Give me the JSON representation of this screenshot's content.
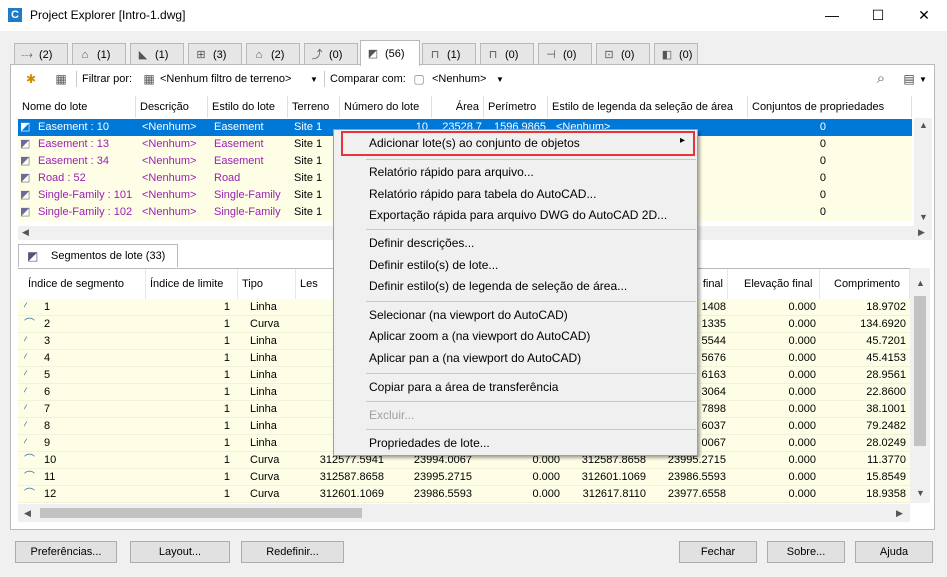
{
  "window": {
    "title": "Project Explorer [Intro-1.dwg]",
    "app_icon_letter": "C",
    "minimize": "—",
    "maximize": "☐",
    "close": "✕"
  },
  "tabs": [
    {
      "icon": "alignment-icon",
      "count": "(2)"
    },
    {
      "icon": "corridor-icon",
      "count": "(1)"
    },
    {
      "icon": "profile-icon",
      "count": "(1)"
    },
    {
      "icon": "section-icon",
      "count": "(3)"
    },
    {
      "icon": "surface-icon",
      "count": "(2)"
    },
    {
      "icon": "feature-line-icon",
      "count": "(0)"
    },
    {
      "icon": "parcel-icon",
      "count": "(56)"
    },
    {
      "icon": "structure-icon",
      "count": "(1)"
    },
    {
      "icon": "pipe-icon",
      "count": "(0)"
    },
    {
      "icon": "point-group-icon",
      "count": "(0)"
    },
    {
      "icon": "assembly-icon",
      "count": "(0)"
    },
    {
      "icon": "label-icon",
      "count": "(0)"
    }
  ],
  "toolbar": {
    "filter_label": "Filtrar por:",
    "filter_value": "<Nenhum filtro de terreno>",
    "compare_label": "Comparar com:",
    "compare_value": "<Nenhum>"
  },
  "parcels": {
    "columns": [
      "Nome do lote",
      "Descrição",
      "Estilo do lote",
      "Terreno",
      "Número do lote",
      "Área",
      "Perímetro",
      "Estilo de legenda da seleção de área",
      "Conjuntos de propriedades"
    ],
    "rows": [
      {
        "name": "Easement : 10",
        "desc": "<Nenhum>",
        "style": "Easement",
        "site": "Site 1",
        "num": "10",
        "area": "23528.7",
        "perim": "1596.9865",
        "label_style": "<Nenhum>",
        "sets": "0"
      },
      {
        "name": "Easement : 13",
        "desc": "<Nenhum>",
        "style": "Easement",
        "site": "Site 1",
        "num": "",
        "area": "",
        "perim": "",
        "label_style": "",
        "sets": "0"
      },
      {
        "name": "Easement : 34",
        "desc": "<Nenhum>",
        "style": "Easement",
        "site": "Site 1",
        "num": "",
        "area": "",
        "perim": "",
        "label_style": "",
        "sets": "0"
      },
      {
        "name": "Road : 52",
        "desc": "<Nenhum>",
        "style": "Road",
        "site": "Site 1",
        "num": "",
        "area": "",
        "perim": "",
        "label_style": "",
        "sets": "0"
      },
      {
        "name": "Single-Family : 101",
        "desc": "<Nenhum>",
        "style": "Single-Family",
        "site": "Site 1",
        "num": "",
        "area": "",
        "perim": "",
        "label_style": "",
        "sets": "0"
      },
      {
        "name": "Single-Family : 102",
        "desc": "<Nenhum>",
        "style": "Single-Family",
        "site": "Site 1",
        "num": "",
        "area": "",
        "perim": "",
        "label_style": "",
        "sets": "0"
      }
    ]
  },
  "segments_tab": "Segmentos de lote (33)",
  "segments": {
    "columns": [
      "Índice de segmento",
      "Índice de limite",
      "Tipo",
      "Les",
      "",
      "",
      "final",
      "Elevação final",
      "Comprimento"
    ],
    "rows": [
      {
        "idx": "1",
        "lim": "1",
        "type": "Linha",
        "a": "3124",
        "b": "",
        "c": "",
        "d": "",
        "e": "1408",
        "elev": "0.000",
        "len": "18.9702"
      },
      {
        "idx": "2",
        "lim": "1",
        "type": "Curva",
        "a": "3124",
        "b": "",
        "c": "",
        "d": "",
        "e": "1335",
        "elev": "0.000",
        "len": "134.6920"
      },
      {
        "idx": "3",
        "lim": "1",
        "type": "Linha",
        "a": "3125",
        "b": "",
        "c": "",
        "d": "",
        "e": "5544",
        "elev": "0.000",
        "len": "45.7201"
      },
      {
        "idx": "4",
        "lim": "1",
        "type": "Linha",
        "a": "3125",
        "b": "",
        "c": "",
        "d": "",
        "e": "5676",
        "elev": "0.000",
        "len": "45.4153"
      },
      {
        "idx": "5",
        "lim": "1",
        "type": "Linha",
        "a": "3125",
        "b": "",
        "c": "",
        "d": "",
        "e": "6163",
        "elev": "0.000",
        "len": "28.9561"
      },
      {
        "idx": "6",
        "lim": "1",
        "type": "Linha",
        "a": "3126",
        "b": "",
        "c": "",
        "d": "",
        "e": "3064",
        "elev": "0.000",
        "len": "22.8600"
      },
      {
        "idx": "7",
        "lim": "1",
        "type": "Linha",
        "a": "3126",
        "b": "",
        "c": "",
        "d": "",
        "e": "7898",
        "elev": "0.000",
        "len": "38.1001"
      },
      {
        "idx": "8",
        "lim": "1",
        "type": "Linha",
        "a": "3126",
        "b": "",
        "c": "",
        "d": "",
        "e": "6037",
        "elev": "0.000",
        "len": "79.2482"
      },
      {
        "idx": "9",
        "lim": "1",
        "type": "Linha",
        "a": "3125",
        "b": "",
        "c": "",
        "d": "",
        "e": "0067",
        "elev": "0.000",
        "len": "28.0249"
      },
      {
        "idx": "10",
        "lim": "1",
        "type": "Curva",
        "a": "312577.5941",
        "b": "23994.0067",
        "c": "0.000",
        "d": "312587.8658",
        "e": "23995.2715",
        "elev": "0.000",
        "len": "11.3770"
      },
      {
        "idx": "11",
        "lim": "1",
        "type": "Curva",
        "a": "312587.8658",
        "b": "23995.2715",
        "c": "0.000",
        "d": "312601.1069",
        "e": "23986.5593",
        "elev": "0.000",
        "len": "15.8549"
      },
      {
        "idx": "12",
        "lim": "1",
        "type": "Curva",
        "a": "312601.1069",
        "b": "23986.5593",
        "c": "0.000",
        "d": "312617.8110",
        "e": "23977.6558",
        "elev": "0.000",
        "len": "18.9358"
      }
    ]
  },
  "context_menu": {
    "items": [
      {
        "label": "Adicionar lote(s) ao conjunto de objetos",
        "submenu": "▸"
      },
      {
        "label": "Relatório rápido para arquivo..."
      },
      {
        "label": "Relatório rápido para tabela do AutoCAD..."
      },
      {
        "label": "Exportação rápida para arquivo DWG do AutoCAD 2D..."
      },
      {
        "label": "Definir descrições..."
      },
      {
        "label": "Definir estilo(s) de lote..."
      },
      {
        "label": "Definir estilo(s) de legenda de seleção de área..."
      },
      {
        "label": "Selecionar (na viewport do AutoCAD)"
      },
      {
        "label": "Aplicar zoom a (na viewport do AutoCAD)"
      },
      {
        "label": "Aplicar pan a (na viewport do AutoCAD)"
      },
      {
        "label": "Copiar para a área de transferência"
      },
      {
        "label": "Excluir..."
      },
      {
        "label": "Propriedades de lote..."
      }
    ]
  },
  "buttons": {
    "prefs": "Preferências...",
    "layout": "Layout...",
    "reset": "Redefinir...",
    "close": "Fechar",
    "about": "Sobre...",
    "help": "Ajuda"
  },
  "colors": {
    "selection": "#0078d7",
    "row_bg": "#fefee6",
    "purple_text": "#9a1fb5",
    "highlight_border": "#e8333b"
  }
}
